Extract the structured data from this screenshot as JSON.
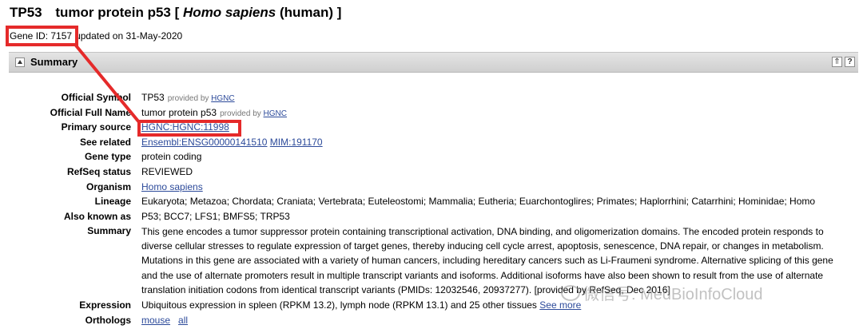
{
  "header": {
    "symbol": "TP53",
    "full_name": "tumor protein p53",
    "bracket_open": "[",
    "species": "Homo sapiens",
    "species_common": "(human)",
    "bracket_close": "]"
  },
  "gene_id": {
    "label": "Gene ID: 7157",
    "updated": "updated on 31-May-2020"
  },
  "summary_section": {
    "heading": "Summary",
    "up_icon_glyph": "⇑",
    "help_icon_glyph": "?"
  },
  "fields": {
    "official_symbol": {
      "label": "Official Symbol",
      "value": "TP53",
      "provided_by": "provided by",
      "provider": "HGNC"
    },
    "official_full_name": {
      "label": "Official Full Name",
      "value": "tumor protein p53",
      "provided_by": "provided by",
      "provider": "HGNC"
    },
    "primary_source": {
      "label": "Primary source",
      "value": "HGNC:HGNC:11998"
    },
    "see_related": {
      "label": "See related",
      "link1": "Ensembl:ENSG00000141510",
      "link2": "MIM:191170"
    },
    "gene_type": {
      "label": "Gene type",
      "value": "protein coding"
    },
    "refseq_status": {
      "label": "RefSeq status",
      "value": "REVIEWED"
    },
    "organism": {
      "label": "Organism",
      "value": "Homo sapiens"
    },
    "lineage": {
      "label": "Lineage",
      "value": "Eukaryota; Metazoa; Chordata; Craniata; Vertebrata; Euteleostomi; Mammalia; Eutheria; Euarchontoglires; Primates; Haplorrhini; Catarrhini; Hominidae; Homo"
    },
    "also_known_as": {
      "label": "Also known as",
      "value": "P53; BCC7; LFS1; BMFS5; TRP53"
    },
    "summary": {
      "label": "Summary",
      "value": "This gene encodes a tumor suppressor protein containing transcriptional activation, DNA binding, and oligomerization domains. The encoded protein responds to diverse cellular stresses to regulate expression of target genes, thereby inducing cell cycle arrest, apoptosis, senescence, DNA repair, or changes in metabolism. Mutations in this gene are associated with a variety of human cancers, including hereditary cancers such as Li-Fraumeni syndrome. Alternative splicing of this gene and the use of alternate promoters result in multiple transcript variants and isoforms. Additional isoforms have also been shown to result from the use of alternate translation initiation codons from identical transcript variants (PMIDs: 12032546, 20937277). [provided by RefSeq, Dec 2016]"
    },
    "expression": {
      "label": "Expression",
      "value": "Ubiquitous expression in spleen (RPKM 13.2), lymph node (RPKM 13.1) and 25 other tissues",
      "link": "See more"
    },
    "orthologs": {
      "label": "Orthologs",
      "link1": "mouse",
      "link2": "all"
    }
  },
  "watermark": {
    "text": "微信号: MedBioInfoCloud"
  },
  "colors": {
    "link": "#2c4a9a",
    "highlight": "#e52a2a",
    "bar": "#d8d8d8"
  }
}
